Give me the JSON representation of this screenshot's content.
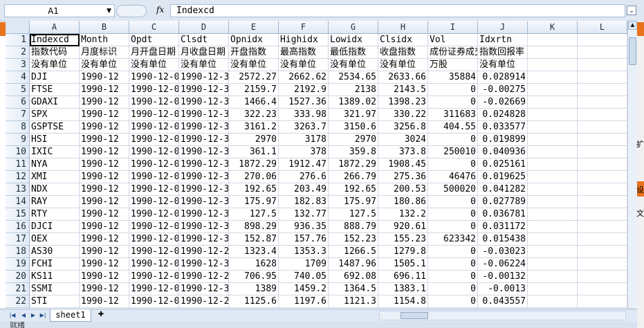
{
  "formula_bar": {
    "name_box": "A1",
    "fx_label": "fx",
    "content": "Indexcd"
  },
  "columns": [
    "A",
    "B",
    "C",
    "D",
    "E",
    "F",
    "G",
    "H",
    "I",
    "J",
    "K",
    "L"
  ],
  "rows": [
    [
      "Indexcd",
      "Month",
      "Opdt",
      "Clsdt",
      "Opnidx",
      "Highidx",
      "Lowidx",
      "Clsidx",
      "Vol",
      "Idxrtn",
      "",
      ""
    ],
    [
      "指数代码",
      "月度标识",
      "月开盘日期",
      "月收盘日期",
      "开盘指数",
      "最高指数",
      "最低指数",
      "收盘指数",
      "成份证券成交",
      "指数回报率",
      "",
      ""
    ],
    [
      "没有单位",
      "没有单位",
      "没有单位",
      "没有单位",
      "没有单位",
      "没有单位",
      "没有单位",
      "没有单位",
      "万股",
      "没有单位",
      "",
      ""
    ],
    [
      "DJI",
      "1990-12",
      "1990-12-03",
      "1990-12-31",
      "2572.27",
      "2662.62",
      "2534.65",
      "2633.66",
      "35884",
      "0.028914",
      "",
      ""
    ],
    [
      "FTSE",
      "1990-12",
      "1990-12-03",
      "1990-12-31",
      "2159.7",
      "2192.9",
      "2138",
      "2143.5",
      "0",
      "-0.00275",
      "",
      ""
    ],
    [
      "GDAXI",
      "1990-12",
      "1990-12-03",
      "1990-12-31",
      "1466.4",
      "1527.36",
      "1389.02",
      "1398.23",
      "0",
      "-0.02669",
      "",
      ""
    ],
    [
      "SPX",
      "1990-12",
      "1990-12-03",
      "1990-12-31",
      "322.23",
      "333.98",
      "321.97",
      "330.22",
      "311683",
      "0.024828",
      "",
      ""
    ],
    [
      "GSPTSE",
      "1990-12",
      "1990-12-03",
      "1990-12-31",
      "3161.2",
      "3263.7",
      "3150.6",
      "3256.8",
      "404.55",
      "0.033577",
      "",
      ""
    ],
    [
      "HSI",
      "1990-12",
      "1990-12-03",
      "1990-12-31",
      "2970",
      "3178",
      "2970",
      "3024",
      "0",
      "0.019899",
      "",
      ""
    ],
    [
      "IXIC",
      "1990-12",
      "1990-12-03",
      "1990-12-31",
      "361.1",
      "378",
      "359.8",
      "373.8",
      "250010",
      "0.040936",
      "",
      ""
    ],
    [
      "NYA",
      "1990-12",
      "1990-12-03",
      "1990-12-31",
      "1872.29",
      "1912.47",
      "1872.29",
      "1908.45",
      "0",
      "0.025161",
      "",
      ""
    ],
    [
      "XMI",
      "1990-12",
      "1990-12-03",
      "1990-12-31",
      "270.06",
      "276.6",
      "266.79",
      "275.36",
      "46476",
      "0.019625",
      "",
      ""
    ],
    [
      "NDX",
      "1990-12",
      "1990-12-03",
      "1990-12-31",
      "192.65",
      "203.49",
      "192.65",
      "200.53",
      "500020",
      "0.041282",
      "",
      ""
    ],
    [
      "RAY",
      "1990-12",
      "1990-12-03",
      "1990-12-31",
      "175.97",
      "182.83",
      "175.97",
      "180.86",
      "0",
      "0.027789",
      "",
      ""
    ],
    [
      "RTY",
      "1990-12",
      "1990-12-03",
      "1990-12-31",
      "127.5",
      "132.77",
      "127.5",
      "132.2",
      "0",
      "0.036781",
      "",
      ""
    ],
    [
      "DJCI",
      "1990-12",
      "1990-12-03",
      "1990-12-31",
      "898.29",
      "936.35",
      "888.79",
      "920.61",
      "0",
      "0.031172",
      "",
      ""
    ],
    [
      "OEX",
      "1990-12",
      "1990-12-03",
      "1990-12-31",
      "152.87",
      "157.76",
      "152.23",
      "155.23",
      "623342",
      "0.015438",
      "",
      ""
    ],
    [
      "AS30",
      "1990-12",
      "1990-12-03",
      "1990-12-24",
      "1323.4",
      "1353.3",
      "1266.5",
      "1279.8",
      "0",
      "-0.03023",
      "",
      ""
    ],
    [
      "FCHI",
      "1990-12",
      "1990-12-03",
      "1990-12-31",
      "1628",
      "1709",
      "1487.96",
      "1505.1",
      "0",
      "-0.06224",
      "",
      ""
    ],
    [
      "KS11",
      "1990-12",
      "1990-12-03",
      "1990-12-26",
      "706.95",
      "740.05",
      "692.08",
      "696.11",
      "0",
      "-0.00132",
      "",
      ""
    ],
    [
      "SSMI",
      "1990-12",
      "1990-12-03",
      "1990-12-31",
      "1389",
      "1459.2",
      "1364.5",
      "1383.1",
      "0",
      "-0.0013",
      "",
      ""
    ],
    [
      "STI",
      "1990-12",
      "1990-12-03",
      "1990-12-24",
      "1125.6",
      "1197.6",
      "1121.3",
      "1154.8",
      "0",
      "0.043557",
      "",
      ""
    ]
  ],
  "sheet_tabs": [
    "sheet1"
  ],
  "status": {
    "text": "就绪"
  },
  "right_strip_chars": [
    "扩",
    "设",
    "文"
  ],
  "colors": {
    "accent_orange": "#e9721d",
    "header_blue": "#dfe8f4",
    "grid_line": "#d0d7e5"
  }
}
